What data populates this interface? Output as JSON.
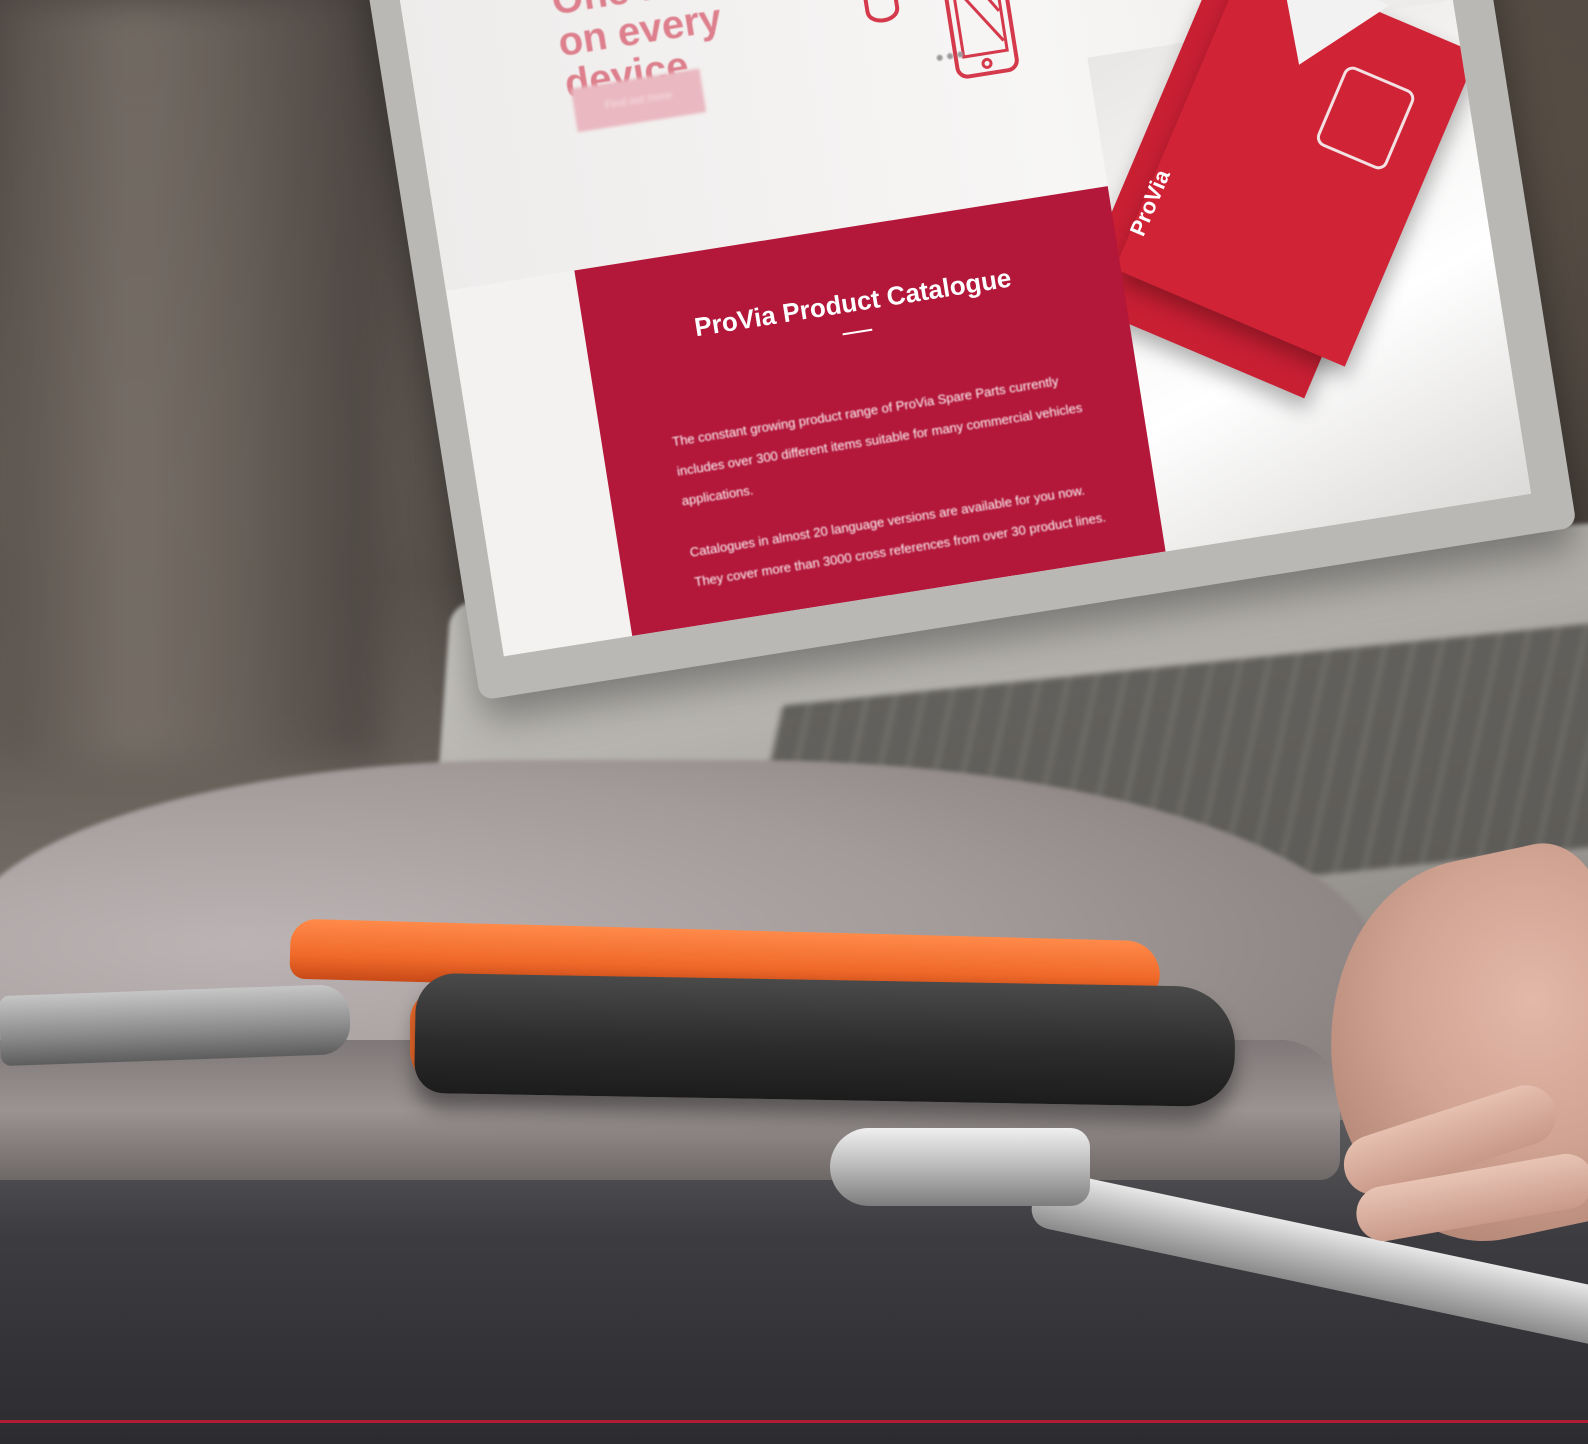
{
  "screen": {
    "hero_title_line1": "One Provia",
    "hero_title_line2": "on every device",
    "hero_button_label": "Find out more",
    "catalogue_title": "ProVia Product Catalogue",
    "catalogue_paragraph1": "The constant growing product range of ProVia Spare Parts currently includes over 300 different items suitable for many commercial vehicles applications.",
    "catalogue_paragraph2": "Catalogues in almost 20 language versions are available for you now. They cover more than 3000 cross references from over 30 product lines.",
    "brochure_logo": "ProVia"
  },
  "colors": {
    "brand_red": "#b3173a",
    "hero_text": "#dd7f8c",
    "desk_accent_line": "#b01c33"
  },
  "icons": [
    "mouse-icon",
    "smartphone-icon"
  ]
}
